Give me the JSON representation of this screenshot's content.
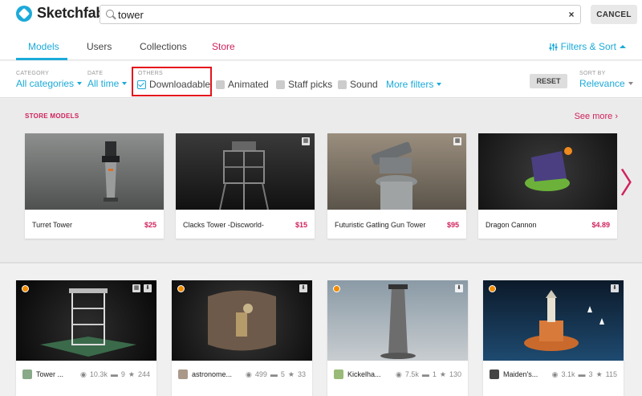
{
  "header": {
    "brand": "Sketchfab",
    "search_value": "tower",
    "clear_glyph": "×",
    "cancel_label": "CANCEL"
  },
  "tabs": [
    {
      "label": "Models",
      "active": true
    },
    {
      "label": "Users"
    },
    {
      "label": "Collections"
    },
    {
      "label": "Store"
    }
  ],
  "filters_sort_label": "Filters & Sort",
  "filters": {
    "category": {
      "label": "CATEGORY",
      "value": "All categories"
    },
    "date": {
      "label": "DATE",
      "value": "All time"
    },
    "others": {
      "label": "OTHERS"
    },
    "downloadable": "Downloadable",
    "animated": "Animated",
    "staff_picks": "Staff picks",
    "sound": "Sound",
    "more_filters": "More filters",
    "reset": "RESET",
    "sort": {
      "label": "SORT BY",
      "value": "Relevance"
    }
  },
  "store": {
    "title": "STORE MODELS",
    "see_more": "See more ›",
    "items": [
      {
        "name": "Turret Tower",
        "price": "$25"
      },
      {
        "name": "Clacks Tower -Discworld-",
        "price": "$15"
      },
      {
        "name": "Futuristic Gatling Gun Tower",
        "price": "$95"
      },
      {
        "name": "Dragon Cannon",
        "price": "$4.89"
      }
    ]
  },
  "models": [
    {
      "name": "Tower ...",
      "views": "10.3k",
      "comments": "9",
      "likes": "244"
    },
    {
      "name": "astronome...",
      "views": "499",
      "comments": "5",
      "likes": "33"
    },
    {
      "name": "Kickelha...",
      "views": "7.5k",
      "comments": "1",
      "likes": "130"
    },
    {
      "name": "Maiden's...",
      "views": "3.1k",
      "comments": "3",
      "likes": "115"
    }
  ],
  "colors": {
    "accent": "#1caad9",
    "store": "#d1215c",
    "highlight": "#e4121b"
  }
}
